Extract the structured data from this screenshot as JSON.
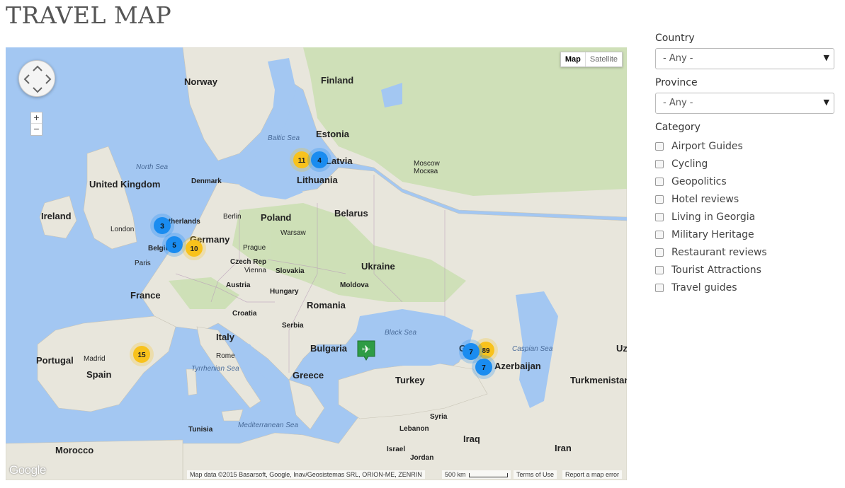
{
  "page": {
    "title": "TRAVEL MAP"
  },
  "map": {
    "type_buttons": {
      "map": "Map",
      "satellite": "Satellite"
    },
    "zoom": {
      "in": "+",
      "out": "−"
    },
    "logo": "Google",
    "attribution": "Map data ©2015 Basarsoft, Google, Inav/Geosistemas SRL, ORION-ME, ZENRIN",
    "scale_label": "500 km",
    "terms": "Terms of Use",
    "report": "Report a map error",
    "colors": {
      "water": "#a3c7f2",
      "land": "#e8e6dc",
      "forest": "#c8dfaf",
      "cluster_blue": "#1a8cf0",
      "cluster_yellow": "#f8c21c",
      "marker_green": "#2e9c45"
    },
    "labels": {
      "norway": "Norway",
      "finland": "Finland",
      "estonia": "Estonia",
      "latvia": "Latvia",
      "lithuania": "Lithuania",
      "baltic_sea": "Baltic Sea",
      "north_sea": "North Sea",
      "denmark": "Denmark",
      "uk": "United Kingdom",
      "ireland": "Ireland",
      "london": "London",
      "netherlands": "Netherlands",
      "belgium": "Belgium",
      "berlin": "Berlin",
      "poland": "Poland",
      "warsaw": "Warsaw",
      "belarus": "Belarus",
      "moscow": "Moscow",
      "moscow_ru": "Москва",
      "germany": "Germany",
      "prague": "Prague",
      "czech": "Czech Rep",
      "vienna": "Vienna",
      "slovakia": "Slovakia",
      "paris": "Paris",
      "austria": "Austria",
      "hungary": "Hungary",
      "ukraine": "Ukraine",
      "moldova": "Moldova",
      "france": "France",
      "romania": "Romania",
      "croatia": "Croatia",
      "serbia": "Serbia",
      "italy": "Italy",
      "rome": "Rome",
      "bulgaria": "Bulgaria",
      "black_sea": "Black Sea",
      "portugal": "Portugal",
      "madrid": "Madrid",
      "spain": "Spain",
      "tyrrhenian": "Tyrrhenian Sea",
      "greece": "Greece",
      "turkey": "Turkey",
      "caspian": "Caspian Sea",
      "azerbaijan": "Azerbaijan",
      "turkmenistan": "Turkmenistan",
      "uz": "Uz",
      "syria": "Syria",
      "lebanon": "Lebanon",
      "iraq": "Iraq",
      "iran": "Iran",
      "israel": "Israel",
      "jordan": "Jordan",
      "tunisia": "Tunisia",
      "mediterranean": "Mediterranean Sea",
      "morocco": "Morocco",
      "georgia_partial": "G"
    },
    "clusters": [
      {
        "count": "11",
        "color": "yellow"
      },
      {
        "count": "4",
        "color": "blue"
      },
      {
        "count": "3",
        "color": "blue"
      },
      {
        "count": "5",
        "color": "blue"
      },
      {
        "count": "10",
        "color": "yellow"
      },
      {
        "count": "15",
        "color": "yellow"
      },
      {
        "count": "7",
        "color": "blue"
      },
      {
        "count": "89",
        "color": "yellow"
      },
      {
        "count": "7",
        "color": "blue"
      }
    ]
  },
  "filters": {
    "country": {
      "label": "Country",
      "value": "- Any -"
    },
    "province": {
      "label": "Province",
      "value": "- Any -"
    },
    "category": {
      "label": "Category",
      "items": [
        "Airport Guides",
        "Cycling",
        "Geopolitics",
        "Hotel reviews",
        "Living in Georgia",
        "Military Heritage",
        "Restaurant reviews",
        "Tourist Attractions",
        "Travel guides"
      ]
    }
  }
}
